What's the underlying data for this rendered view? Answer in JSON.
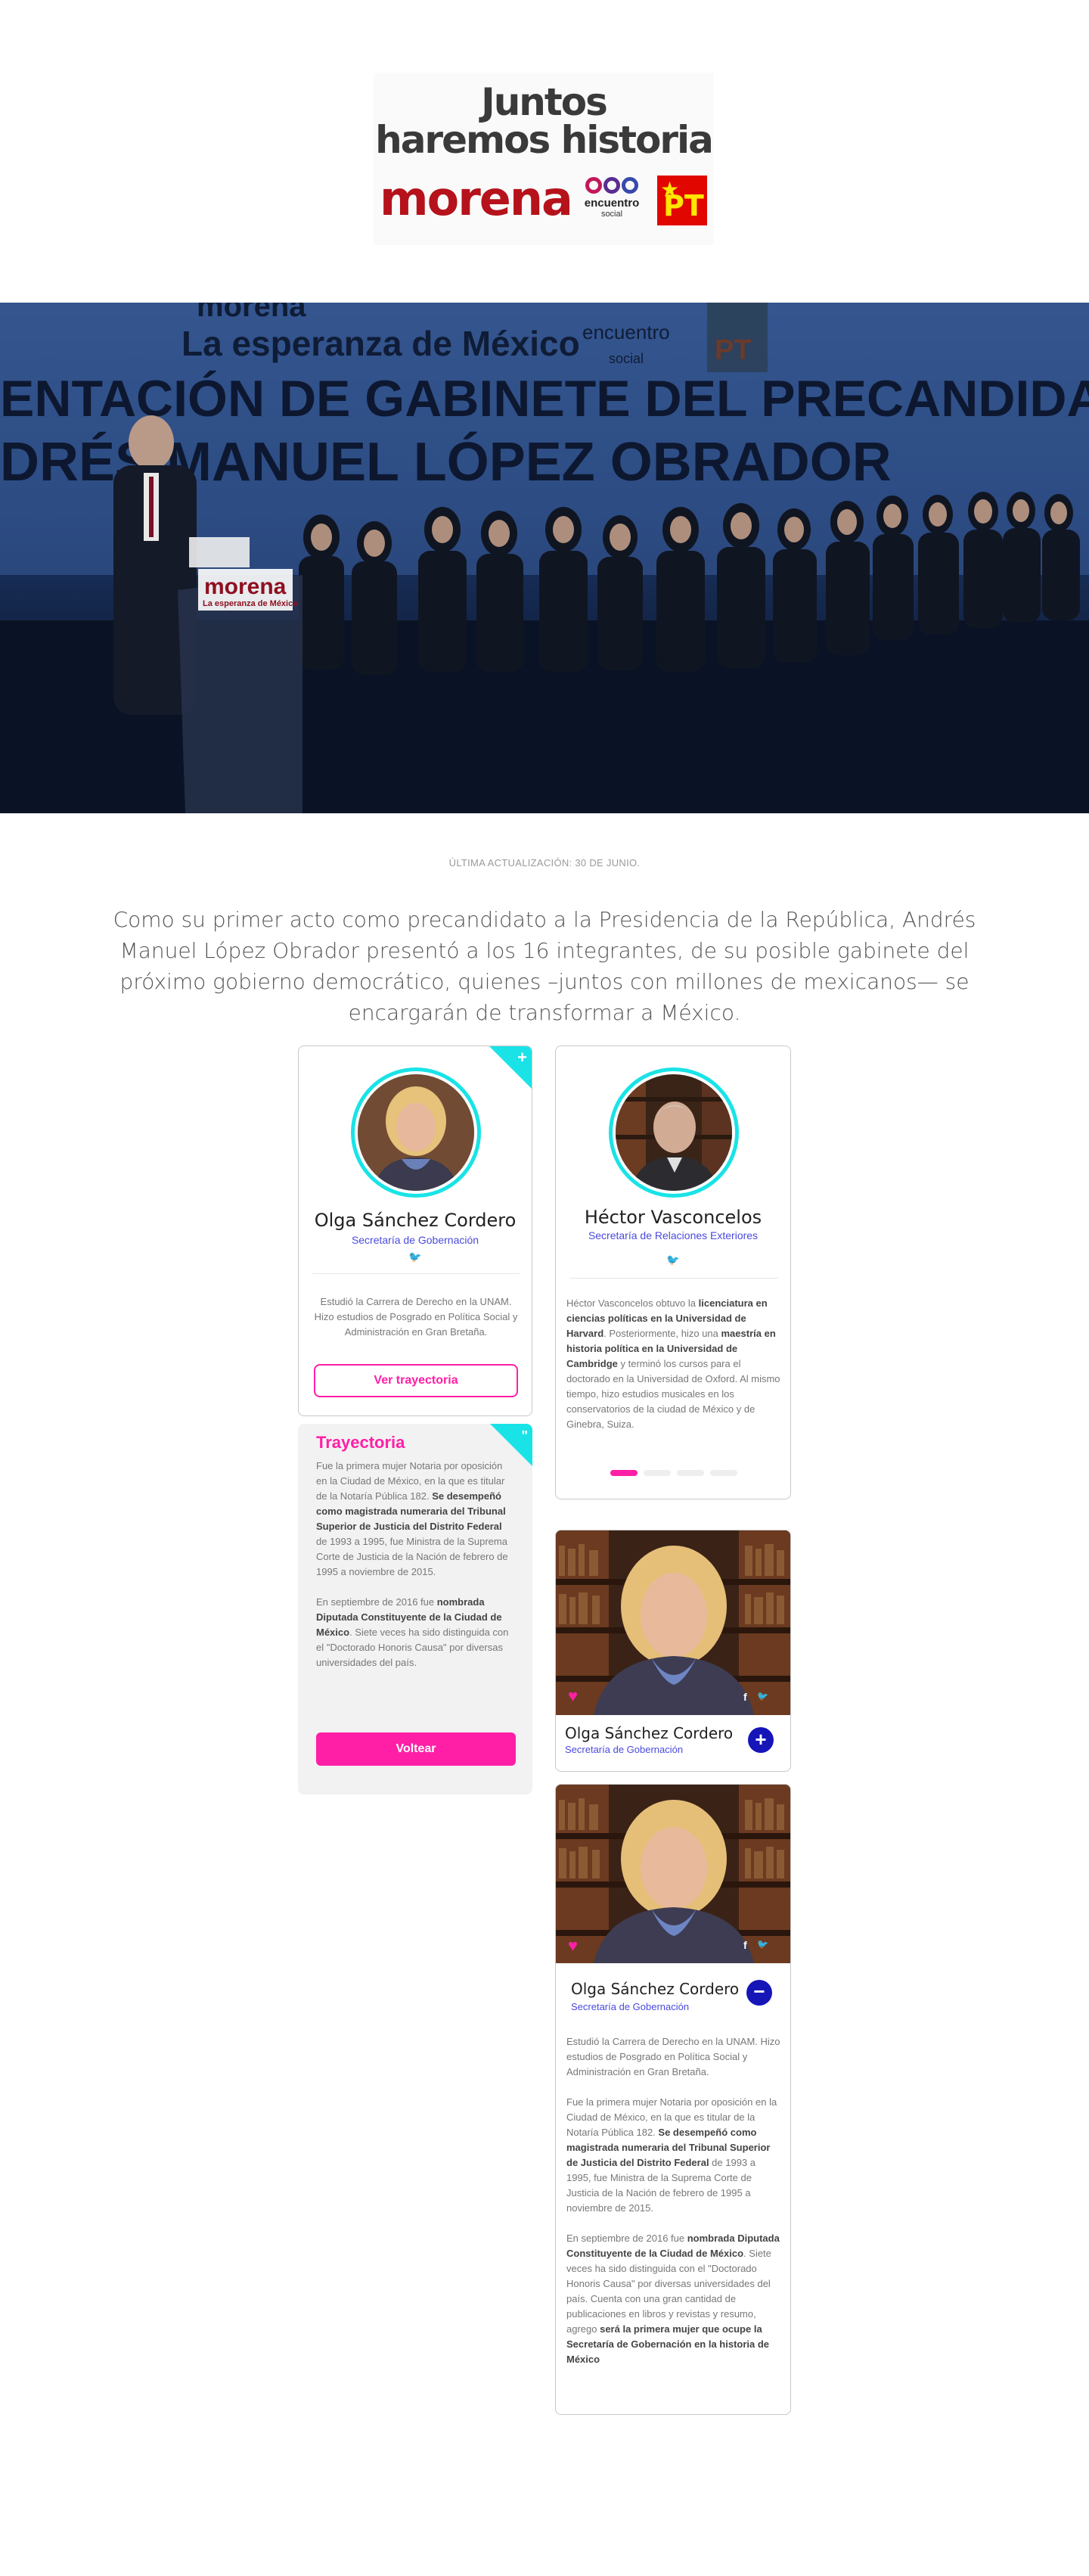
{
  "logo": {
    "line1": "Juntos",
    "line2": "haremos historia",
    "party1": "morena",
    "party2_line1": "encuentro",
    "party2_line2": "social",
    "party3": "PT"
  },
  "hero": {
    "banner_line1": "La esperanza de México",
    "banner_line2": "ENTACIÓN DE GABINETE DEL PRECANDIDATO",
    "banner_line3": "DRÉS MANUEL LÓPEZ OBRADOR",
    "banner_party": "morena",
    "banner_es1": "encuentro",
    "banner_es2": "social",
    "banner_pt": "PT",
    "podium_text1": "morena",
    "podium_text2": "La esperanza de México"
  },
  "update_text": "ÚLTIMA ACTUALIZACIÓN: 30 DE JUNIO.",
  "intro_text": "Como su primer acto como precandidato a la Presidencia de la República, Andrés Manuel López Obrador presentó a los 16 integrantes, de su posible gabinete del próximo gobierno democrático, quienes –juntos con millones de mexicanos— se encargarán de transformar a México.",
  "card1": {
    "corner": "+",
    "name": "Olga Sánchez Cordero",
    "role": "Secretaría de Gobernación",
    "twitter": "🐦",
    "bio": "Estudió la Carrera de Derecho en la UNAM. Hizo estudios de Posgrado en Política Social y Administración en Gran Bretaña.",
    "button": "Ver trayectoria"
  },
  "card2": {
    "title": "Trayectoria",
    "corner": "\"",
    "p1_a": "Fue la primera mujer Notaria por oposición en la Ciudad de México, en la que es titular de la Notaría Pública 182. ",
    "p1_b": "Se desempeñó como magistrada numeraria del Tribunal Superior de Justicia del Distrito Federal",
    "p1_c": " de 1993 a 1995,  fue Ministra de la Suprema Corte de Justicia de la Nación de febrero de 1995 a noviembre de 2015.",
    "p2_a": "En septiembre de 2016 fue ",
    "p2_b": "nombrada Diputada Constituyente de la Ciudad de México",
    "p2_c": ". Siete veces ha sido distinguida con el \"Doctorado Honoris Causa\" por diversas universidades del país.",
    "button": "Voltear"
  },
  "card3": {
    "name": "Héctor Vasconcelos",
    "role": "Secretaría de Relaciones Exteriores",
    "twitter": "🐦",
    "bio_a": "Héctor Vasconcelos obtuvo la ",
    "bio_b": "licenciatura en ciencias políticas en la Universidad de Harvard",
    "bio_c": ". Posteriormente, hizo una ",
    "bio_d": "maestría en historia política en la Universidad de Cambridge",
    "bio_e": " y terminó los cursos para el doctorado en la Universidad de Oxford. Al mismo tiempo, hizo estudios musicales en los conservatorios de la ciudad de México y de Ginebra, Suiza."
  },
  "card4": {
    "name": "Olga Sánchez Cordero",
    "role": "Secretaría de Gobernación",
    "heart": "♥",
    "facebook": "f",
    "twitter": "🐦",
    "button": "+"
  },
  "card5": {
    "name": "Olga Sánchez Cordero",
    "role": "Secretaría de Gobernación",
    "heart": "♥",
    "facebook": "f",
    "twitter": "🐦",
    "button": "−",
    "p1": "Estudió la Carrera de Derecho en la UNAM. Hizo estudios de Posgrado en Política Social y Administración en Gran Bretaña.",
    "p2_a": "Fue la primera mujer Notaria por oposición en la Ciudad de México, en la que es titular de la Notaría Pública 182. ",
    "p2_b": "Se desempeñó como magistrada numeraria del Tribunal Superior de Justicia del Distrito Federal",
    "p2_c": " de 1993 a 1995,  fue Ministra de la Suprema Corte de Justicia de la Nación de febrero de 1995 a noviembre de 2015.",
    "p3_a": "En septiembre de 2016 fue ",
    "p3_b": "nombrada Diputada Constituyente de la Ciudad de México",
    "p3_c": ". Siete veces ha sido distinguida con el \"Doctorado Honoris Causa\" por diversas universidades del país.  Cuenta con una gran cantidad de publicaciones en libros y revistas y resumo, agrego ",
    "p3_d": "será la primera mujer que ocupe la Secretaría de Gobernación en la historia de México"
  },
  "colors": {
    "accent_cyan": "#19e3e6",
    "accent_pink": "#ff1fa6",
    "accent_blue": "#1515b8",
    "morena_red": "#b5121b"
  }
}
